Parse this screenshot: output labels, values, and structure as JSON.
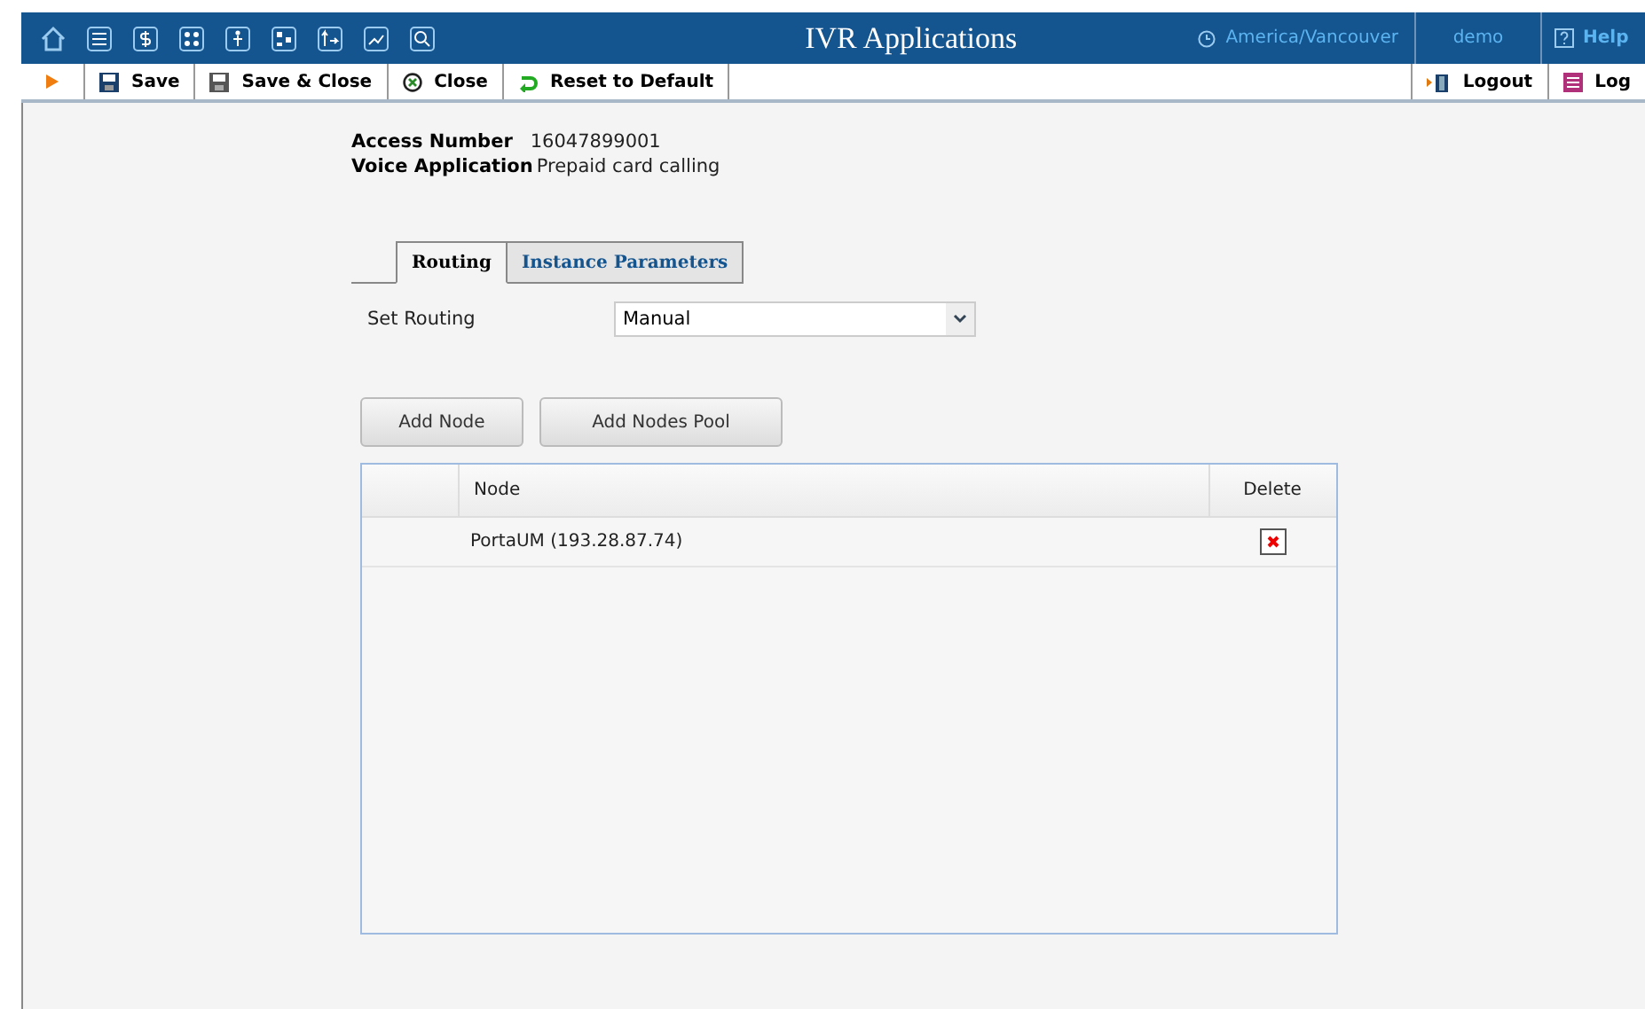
{
  "header": {
    "title": "IVR Applications",
    "timezone": "America/Vancouver",
    "user": "demo",
    "help": "Help"
  },
  "toolbar": {
    "left": [
      {
        "kind": "save",
        "label": "Save"
      },
      {
        "kind": "saveclose",
        "label": "Save & Close"
      },
      {
        "kind": "close",
        "label": "Close"
      },
      {
        "kind": "reset",
        "label": "Reset to Default"
      }
    ],
    "right": [
      {
        "kind": "logout",
        "label": "Logout"
      },
      {
        "kind": "log",
        "label": "Log"
      }
    ]
  },
  "info": [
    {
      "label": "Access Number",
      "value": "16047899001"
    },
    {
      "label": "Voice Application",
      "value": "Prepaid card calling"
    }
  ],
  "tabs": [
    {
      "label": "Routing",
      "selected": true
    },
    {
      "label": "Instance Parameters",
      "selected": false
    }
  ],
  "routing": {
    "label": "Set Routing",
    "value": "Manual"
  },
  "buttons": [
    "Add Node",
    "Add Nodes Pool"
  ],
  "table": {
    "columns": [
      "Node",
      "Delete"
    ],
    "rows": [
      {
        "node": "PortaUM (193.28.87.74)"
      }
    ]
  }
}
